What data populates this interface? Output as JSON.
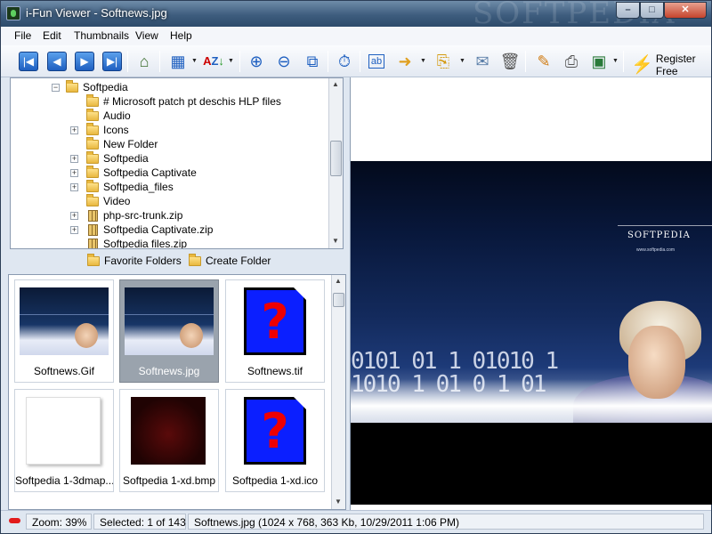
{
  "window": {
    "title": "i-Fun Viewer - Softnews.jpg",
    "watermark": "SOFTPEDIA",
    "controls": {
      "minimize": "–",
      "maximize": "□",
      "close": "✕"
    }
  },
  "menu": [
    "File",
    "Edit",
    "Thumbnails",
    "View",
    "Help"
  ],
  "toolbar": {
    "icons": [
      "first-icon",
      "previous-icon",
      "next-icon",
      "last-icon",
      "slideshow-icon",
      "view-mode-icon",
      "sort-icon",
      "zoom-in-icon",
      "zoom-out-icon",
      "fit-window-icon",
      "timer-icon",
      "rename-icon",
      "move-icon",
      "copy-icon",
      "email-icon",
      "delete-icon",
      "edit-icon",
      "print-icon",
      "wallpaper-icon",
      "lightning-icon"
    ],
    "register_label": "Register Free"
  },
  "tree": {
    "root": "Softpedia",
    "items": [
      "# Microsoft patch pt deschis HLP files",
      "Audio",
      "Icons",
      "New Folder",
      "Softpedia",
      "Softpedia Captivate",
      "Softpedia_files",
      "Video",
      "php-src-trunk.zip",
      "Softpedia Captivate.zip",
      "Softpedia files.zip"
    ]
  },
  "folder_actions": {
    "favorite": "Favorite Folders",
    "create": "Create Folder"
  },
  "thumbnails": [
    {
      "name": "Softnews.Gif",
      "kind": "photo",
      "selected": false
    },
    {
      "name": "Softnews.jpg",
      "kind": "photo",
      "selected": true
    },
    {
      "name": "Softnews.tif",
      "kind": "unknown",
      "selected": false
    },
    {
      "name": "Softpedia 1-3dmap...",
      "kind": "blank",
      "selected": false
    },
    {
      "name": "Softpedia 1-xd.bmp",
      "kind": "dark",
      "selected": false
    },
    {
      "name": "Softpedia 1-xd.ico",
      "kind": "unknown",
      "selected": false
    }
  ],
  "preview": {
    "brand": "SOFTPEDIA",
    "url": "www.softpedia.com"
  },
  "status": {
    "zoom": "Zoom: 39%",
    "selected": "Selected: 1 of 143",
    "file_info": "Softnews.jpg  (1024 x 768, 363 Kb, 10/29/2011 1:06 PM)"
  },
  "colors": {
    "accent": "#1e5fc0",
    "selection": "#9aa3ad",
    "error": "#e21b1b"
  }
}
